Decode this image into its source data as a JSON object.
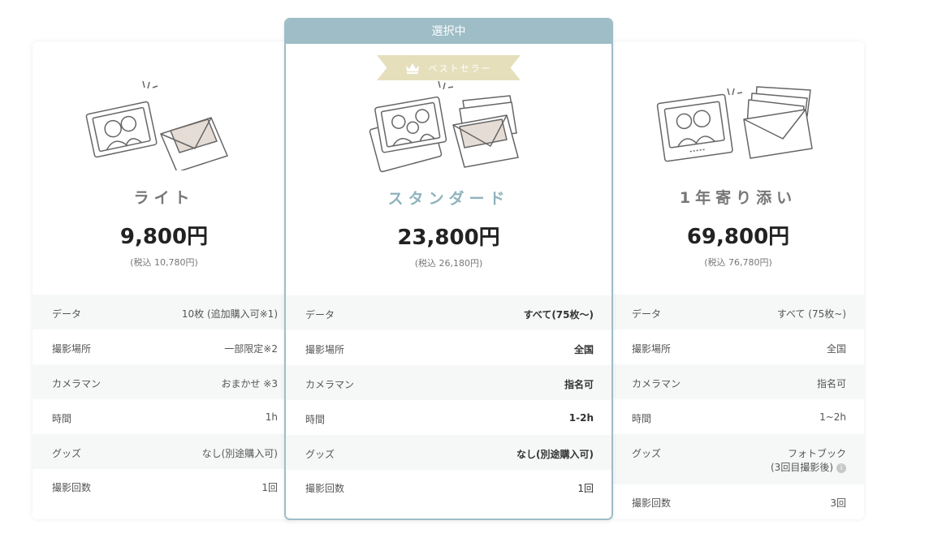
{
  "plans": [
    {
      "name": "ライト",
      "price": "9,800円",
      "tax": "(税込 10,780円)",
      "rows": [
        {
          "label": "データ",
          "value": "10枚 (追加購入可※1)"
        },
        {
          "label": "撮影場所",
          "value": "一部限定※2"
        },
        {
          "label": "カメラマン",
          "value": "おまかせ ※3"
        },
        {
          "label": "時間",
          "value": "1h"
        },
        {
          "label": "グッズ",
          "value": "なし(別途購入可)"
        },
        {
          "label": "撮影回数",
          "value": "1回"
        }
      ]
    },
    {
      "selected_label": "選択中",
      "badge": "ベストセラー",
      "name": "スタンダード",
      "price": "23,800円",
      "tax": "(税込 26,180円)",
      "rows": [
        {
          "label": "データ",
          "value": "すべて(75枚〜)"
        },
        {
          "label": "撮影場所",
          "value": "全国"
        },
        {
          "label": "カメラマン",
          "value": "指名可"
        },
        {
          "label": "時間",
          "value": "1-2h"
        },
        {
          "label": "グッズ",
          "value": "なし(別途購入可)"
        },
        {
          "label": "撮影回数",
          "value": "1回"
        }
      ]
    },
    {
      "name": "1年寄り添い",
      "price": "69,800円",
      "tax": "(税込 76,780円)",
      "rows": [
        {
          "label": "データ",
          "value": "すべて (75枚~)"
        },
        {
          "label": "撮影場所",
          "value": "全国"
        },
        {
          "label": "カメラマン",
          "value": "指名可"
        },
        {
          "label": "時間",
          "value": "1~2h"
        },
        {
          "label": "グッズ",
          "value": "フォトブック",
          "value2": "(3回目撮影後)"
        },
        {
          "label": "撮影回数",
          "value": "3回"
        }
      ]
    }
  ],
  "colors": {
    "accent": "#9ebdc6",
    "badge": "#e6dfbc",
    "row_alt": "#f6f8f8"
  },
  "icons": [
    "crown-icon",
    "info-icon"
  ]
}
